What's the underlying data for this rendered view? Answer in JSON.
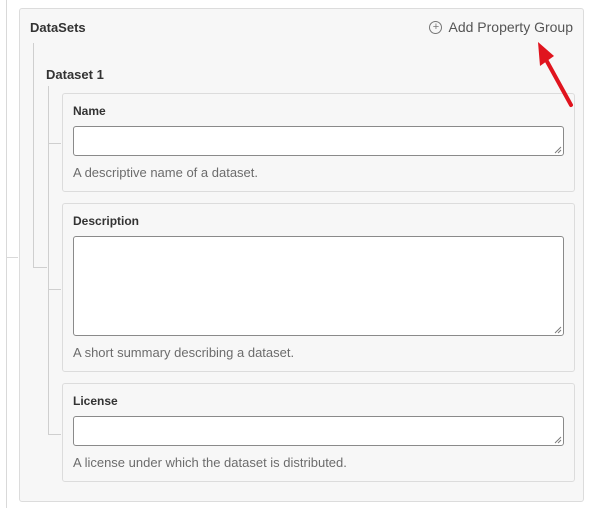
{
  "panel": {
    "title": "DataSets",
    "add_group_label": "Add Property Group",
    "add_group_icon": "plus-circle-icon"
  },
  "dataset": {
    "title": "Dataset 1",
    "fields": [
      {
        "label": "Name",
        "value": "",
        "help": "A descriptive name of a dataset."
      },
      {
        "label": "Description",
        "value": "",
        "help": "A short summary describing a dataset."
      },
      {
        "label": "License",
        "value": "",
        "help": "A license under which the dataset is distributed."
      }
    ]
  },
  "annotation": {
    "arrow_color": "#e0141e",
    "arrow_icon": "red-arrow-icon"
  }
}
